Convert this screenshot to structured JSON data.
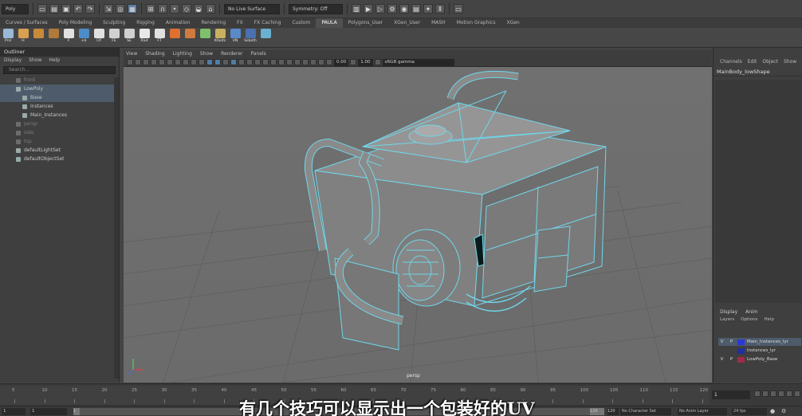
{
  "status_line": {
    "mode_select": "Poly",
    "live_surface": "No Live Surface",
    "symmetry": "Symmetry: Off"
  },
  "shelf_tabs": [
    "Curves / Surfaces",
    "Poly Modeling",
    "Sculpting",
    "Rigging",
    "Animation",
    "Rendering",
    "FX",
    "FX Caching",
    "Custom",
    "PAULA",
    "Polygons_User",
    "XGen_User",
    "MASH",
    "Motion Graphics",
    "XGen"
  ],
  "shelf_active_tab": "PAULA",
  "shelf_buttons": [
    {
      "label": "Prsl",
      "color": "#9ab8d8"
    },
    {
      "label": "H",
      "color": "#d8a050"
    },
    {
      "label": "",
      "color": "#c88a3a"
    },
    {
      "label": "",
      "color": "#b07a3a"
    },
    {
      "label": "F",
      "color": "#e0e0e0"
    },
    {
      "label": "+b",
      "color": "#4c8cc8"
    },
    {
      "label": "CP",
      "color": "#e0e0e0"
    },
    {
      "label": "FE",
      "color": "#d0d0d0"
    },
    {
      "label": "SE",
      "color": "#d0d0d0"
    },
    {
      "label": "Rlut",
      "color": "#e8e8e8"
    },
    {
      "label": "FT",
      "color": "#e0e0e0"
    },
    {
      "label": "",
      "color": "#e07030"
    },
    {
      "label": "",
      "color": "#d07a40"
    },
    {
      "label": "",
      "color": "#7fc06a"
    },
    {
      "label": "Kfoots",
      "color": "#c8b060"
    },
    {
      "label": "VN",
      "color": "#5a8ac8"
    },
    {
      "label": "Ssboth",
      "color": "#4a70b0"
    },
    {
      "label": "",
      "color": "#6ab0d0"
    }
  ],
  "outliner": {
    "title": "Outliner",
    "menu": [
      "Display",
      "Show",
      "Help"
    ],
    "search_placeholder": "Search...",
    "items": [
      {
        "name": "front",
        "indent": 0,
        "selected": false,
        "dim": true
      },
      {
        "name": "LowPoly",
        "indent": 0,
        "selected": true,
        "dim": false
      },
      {
        "name": "Base",
        "indent": 1,
        "selected": true,
        "dim": false
      },
      {
        "name": "Instances",
        "indent": 1,
        "selected": false,
        "dim": false
      },
      {
        "name": "Main_Instances",
        "indent": 1,
        "selected": false,
        "dim": false
      },
      {
        "name": "persp",
        "indent": 0,
        "selected": false,
        "dim": true
      },
      {
        "name": "side",
        "indent": 0,
        "selected": false,
        "dim": true
      },
      {
        "name": "top",
        "indent": 0,
        "selected": false,
        "dim": true
      },
      {
        "name": "defaultLightSet",
        "indent": 0,
        "selected": false,
        "dim": false
      },
      {
        "name": "defaultObjectSet",
        "indent": 0,
        "selected": false,
        "dim": false
      }
    ]
  },
  "viewport": {
    "menu": [
      "View",
      "Shading",
      "Lighting",
      "Show",
      "Renderer",
      "Panels"
    ],
    "exposure": "0.00",
    "gamma": "1.00",
    "colorspace": "sRGB gamma",
    "camera_label": "persp"
  },
  "channel_box": {
    "tabs": [
      "Channels",
      "Edit",
      "Object",
      "Show"
    ],
    "object_name": "MainBody_lowShape"
  },
  "layer_editor": {
    "tabs": [
      "Display",
      "Anim"
    ],
    "menu": [
      "Layers",
      "Options",
      "Help"
    ],
    "layers": [
      {
        "v": "V",
        "p": "P",
        "color": "#2a3ad8",
        "name": "Main_Instances_lyr",
        "highlight": true
      },
      {
        "v": "",
        "p": "",
        "color": "#2030a0",
        "name": "Instances_lyr",
        "highlight": false
      },
      {
        "v": "V",
        "p": "P",
        "color": "#a02a4a",
        "name": "LowPoly_Base",
        "highlight": false
      }
    ]
  },
  "timeline": {
    "ticks": [
      "5",
      "10",
      "15",
      "20",
      "25",
      "30",
      "35",
      "40",
      "45",
      "50",
      "55",
      "60",
      "65",
      "70",
      "75",
      "80",
      "85",
      "90",
      "95",
      "100",
      "105",
      "110",
      "115",
      "120"
    ],
    "current_frame": "1"
  },
  "range_slider": {
    "start": "1",
    "start_inner": "1",
    "end_inner": "120",
    "end": "120",
    "character_set": "No Character Set",
    "anim_layer": "No Anim Layer",
    "fps": "24 fps"
  },
  "subtitle": "有几个技巧可以显示出一个包装好的UV"
}
